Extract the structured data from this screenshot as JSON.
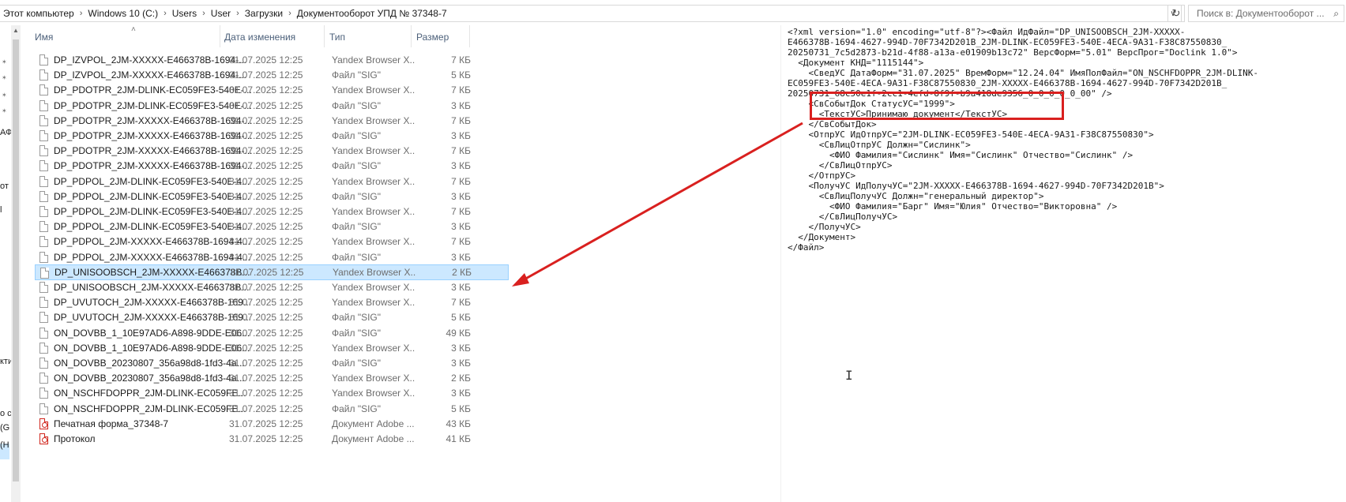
{
  "address_bar": {
    "crumbs": [
      "Этот компьютер",
      "Windows 10 (C:)",
      "Users",
      "User",
      "Загрузки",
      "Документооборот УПД № 37348-7"
    ]
  },
  "search": {
    "placeholder": "Поиск в: Документооборот ..."
  },
  "navpane": {
    "fragments": [
      "АФ",
      "от",
      "l",
      "кти",
      "о с",
      "(G",
      "(H"
    ]
  },
  "columns": {
    "name": "Имя",
    "date": "Дата изменения",
    "type": "Тип",
    "size": "Размер"
  },
  "files": [
    {
      "name": "DP_IZVPOL_2JM-XXXXX-E466378B-1694-...",
      "date": "31.07.2025 12:25",
      "type": "Yandex Browser X...",
      "size": "7 КБ",
      "icon": "document-icon"
    },
    {
      "name": "DP_IZVPOL_2JM-XXXXX-E466378B-1694-...",
      "date": "31.07.2025 12:25",
      "type": "Файл \"SIG\"",
      "size": "5 КБ",
      "icon": "document-icon"
    },
    {
      "name": "DP_PDOTPR_2JM-DLINK-EC059FE3-540E-...",
      "date": "31.07.2025 12:25",
      "type": "Yandex Browser X...",
      "size": "7 КБ",
      "icon": "document-icon"
    },
    {
      "name": "DP_PDOTPR_2JM-DLINK-EC059FE3-540E-...",
      "date": "31.07.2025 12:25",
      "type": "Файл \"SIG\"",
      "size": "3 КБ",
      "icon": "document-icon"
    },
    {
      "name": "DP_PDOTPR_2JM-XXXXX-E466378B-1694-...",
      "date": "31.07.2025 12:25",
      "type": "Yandex Browser X...",
      "size": "7 КБ",
      "icon": "document-icon"
    },
    {
      "name": "DP_PDOTPR_2JM-XXXXX-E466378B-1694-...",
      "date": "31.07.2025 12:25",
      "type": "Файл \"SIG\"",
      "size": "3 КБ",
      "icon": "document-icon"
    },
    {
      "name": "DP_PDOTPR_2JM-XXXXX-E466378B-1694-...",
      "date": "31.07.2025 12:25",
      "type": "Yandex Browser X...",
      "size": "7 КБ",
      "icon": "document-icon"
    },
    {
      "name": "DP_PDOTPR_2JM-XXXXX-E466378B-1694-...",
      "date": "31.07.2025 12:25",
      "type": "Файл \"SIG\"",
      "size": "3 КБ",
      "icon": "document-icon"
    },
    {
      "name": "DP_PDPOL_2JM-DLINK-EC059FE3-540E-4...",
      "date": "31.07.2025 12:25",
      "type": "Yandex Browser X...",
      "size": "7 КБ",
      "icon": "document-icon"
    },
    {
      "name": "DP_PDPOL_2JM-DLINK-EC059FE3-540E-4...",
      "date": "31.07.2025 12:25",
      "type": "Файл \"SIG\"",
      "size": "3 КБ",
      "icon": "document-icon"
    },
    {
      "name": "DP_PDPOL_2JM-DLINK-EC059FE3-540E-4...",
      "date": "31.07.2025 12:25",
      "type": "Yandex Browser X...",
      "size": "7 КБ",
      "icon": "document-icon"
    },
    {
      "name": "DP_PDPOL_2JM-DLINK-EC059FE3-540E-4...",
      "date": "31.07.2025 12:25",
      "type": "Файл \"SIG\"",
      "size": "3 КБ",
      "icon": "document-icon"
    },
    {
      "name": "DP_PDPOL_2JM-XXXXX-E466378B-1694-4...",
      "date": "31.07.2025 12:25",
      "type": "Yandex Browser X...",
      "size": "7 КБ",
      "icon": "document-icon"
    },
    {
      "name": "DP_PDPOL_2JM-XXXXX-E466378B-1694-4...",
      "date": "31.07.2025 12:25",
      "type": "Файл \"SIG\"",
      "size": "3 КБ",
      "icon": "document-icon"
    },
    {
      "name": "DP_UNISOOBSCH_2JM-XXXXX-E466378B...",
      "date": "31.07.2025 12:25",
      "type": "Yandex Browser X...",
      "size": "2 КБ",
      "icon": "document-icon",
      "selected": true
    },
    {
      "name": "DP_UNISOOBSCH_2JM-XXXXX-E466378B...",
      "date": "31.07.2025 12:25",
      "type": "Yandex Browser X...",
      "size": "3 КБ",
      "icon": "document-icon"
    },
    {
      "name": "DP_UVUTOCH_2JM-XXXXX-E466378B-169...",
      "date": "31.07.2025 12:25",
      "type": "Yandex Browser X...",
      "size": "7 КБ",
      "icon": "document-icon"
    },
    {
      "name": "DP_UVUTOCH_2JM-XXXXX-E466378B-169...",
      "date": "31.07.2025 12:25",
      "type": "Файл \"SIG\"",
      "size": "5 КБ",
      "icon": "document-icon"
    },
    {
      "name": "ON_DOVBB_1_10E97AD6-A898-9DDE-E06...",
      "date": "31.07.2025 12:25",
      "type": "Файл \"SIG\"",
      "size": "49 КБ",
      "icon": "document-icon"
    },
    {
      "name": "ON_DOVBB_1_10E97AD6-A898-9DDE-E06...",
      "date": "31.07.2025 12:25",
      "type": "Yandex Browser X...",
      "size": "3 КБ",
      "icon": "document-icon"
    },
    {
      "name": "ON_DOVBB_20230807_356a98d8-1fd3-4a...",
      "date": "31.07.2025 12:25",
      "type": "Файл \"SIG\"",
      "size": "3 КБ",
      "icon": "document-icon"
    },
    {
      "name": "ON_DOVBB_20230807_356a98d8-1fd3-4a...",
      "date": "31.07.2025 12:25",
      "type": "Yandex Browser X...",
      "size": "2 КБ",
      "icon": "document-icon"
    },
    {
      "name": "ON_NSCHFDOPPR_2JM-DLINK-EC059FE...",
      "date": "31.07.2025 12:25",
      "type": "Yandex Browser X...",
      "size": "3 КБ",
      "icon": "document-icon"
    },
    {
      "name": "ON_NSCHFDOPPR_2JM-DLINK-EC059FE...",
      "date": "31.07.2025 12:25",
      "type": "Файл \"SIG\"",
      "size": "5 КБ",
      "icon": "document-icon"
    },
    {
      "name": "Печатная форма_37348-7",
      "date": "31.07.2025 12:25",
      "type": "Документ Adobe ...",
      "size": "43 КБ",
      "icon": "pdf-icon"
    },
    {
      "name": "Протокол",
      "date": "31.07.2025 12:25",
      "type": "Документ Adobe ...",
      "size": "41 КБ",
      "icon": "pdf-icon"
    }
  ],
  "preview": {
    "xml_lines": [
      "<?xml version=\"1.0\" encoding=\"utf-8\"?><Файл ИдФайл=\"DP_UNISOOBSCH_2JM-XXXXX-",
      "E466378B-1694-4627-994D-70F7342D201B_2JM-DLINK-EC059FE3-540E-4ECA-9A31-F38C87550830_",
      "20250731_7c5d2873-b21d-4f88-a13a-e01909b13c72\" ВерсФорм=\"5.01\" ВерсПрог=\"Doclink 1.0\">",
      "  <Документ КНД=\"1115144\">",
      "    <СведУС ДатаФорм=\"31.07.2025\" ВремФорм=\"12.24.04\" ИмяПолФайл=\"ON_NSCHFDOPPR_2JM-DLINK-",
      "EC059FE3-540E-4ECA-9A31-F38C87550830_2JM-XXXXX-E466378B-1694-4627-994D-70F7342D201B_",
      "20250731_68c50e1f-2cc1-4efd-8f9f-b9a418de9356_0_0_0_0_0_00\" />",
      "    <СвСобытДок СтатусУС=\"1999\">",
      "      <ТекстУС>Принимаю документ</ТекстУС>",
      "    </СвСобытДок>",
      "    <ОтпрУС ИдОтпрУС=\"2JM-DLINK-EC059FE3-540E-4ECA-9A31-F38C87550830\">",
      "      <СвЛицОтпрУС Должн=\"Сислинк\">",
      "        <ФИО Фамилия=\"Сислинк\" Имя=\"Сислинк\" Отчество=\"Сислинк\" />",
      "      </СвЛицОтпрУС>",
      "    </ОтпрУС>",
      "    <ПолучУС ИдПолучУС=\"2JM-XXXXX-E466378B-1694-4627-994D-70F7342D201B\">",
      "      <СвЛицПолучУС Должн=\"генеральный директор\">",
      "        <ФИО Фамилия=\"Барг\" Имя=\"Юлия\" Отчество=\"Викторовна\" />",
      "      </СвЛицПолучУС>",
      "    </ПолучУС>",
      "  </Документ>",
      "</Файл>"
    ]
  },
  "colors": {
    "selection": "#cce8ff",
    "annotation": "#d9201f",
    "header_text": "#4c607a"
  }
}
